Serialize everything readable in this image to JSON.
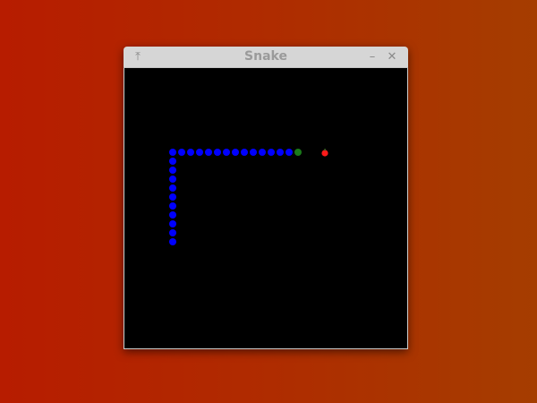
{
  "window": {
    "title": "Snake",
    "pin_icon": "pin-icon",
    "minimize_icon": "minimize-icon",
    "close_icon": "close-icon"
  },
  "game": {
    "grid_cell": 10,
    "snake_color": "#0000ff",
    "head_color": "#1a7a1a",
    "apple_color": "#ff1a1a",
    "snake_head": [
      14,
      9
    ],
    "snake_body": [
      [
        13,
        9
      ],
      [
        12,
        9
      ],
      [
        11,
        9
      ],
      [
        10,
        9
      ],
      [
        9,
        9
      ],
      [
        8,
        9
      ],
      [
        7,
        9
      ],
      [
        6,
        9
      ],
      [
        5,
        9
      ],
      [
        4,
        9
      ],
      [
        3,
        9
      ],
      [
        2,
        9
      ],
      [
        1,
        9
      ],
      [
        0,
        9
      ],
      [
        0,
        10
      ],
      [
        0,
        11
      ],
      [
        0,
        12
      ],
      [
        0,
        13
      ],
      [
        0,
        14
      ],
      [
        0,
        15
      ],
      [
        0,
        16
      ],
      [
        0,
        17
      ],
      [
        0,
        18
      ],
      [
        0,
        19
      ]
    ],
    "apple": [
      17,
      9
    ]
  }
}
